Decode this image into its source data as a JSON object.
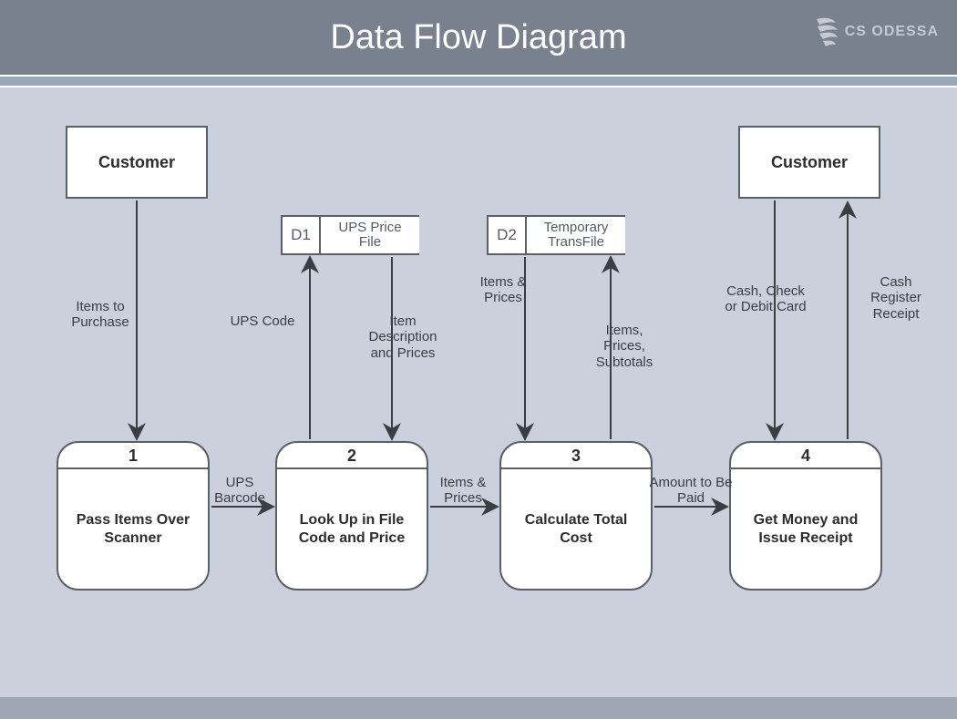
{
  "header": {
    "title": "Data Flow Diagram",
    "brand": "CS ODESSA"
  },
  "entities": {
    "customer_left": "Customer",
    "customer_right": "Customer"
  },
  "datastores": {
    "d1": {
      "id": "D1",
      "name": "UPS Price File"
    },
    "d2": {
      "id": "D2",
      "name": "Temporary TransFile"
    }
  },
  "processes": {
    "p1": {
      "num": "1",
      "label": "Pass Items Over Scanner"
    },
    "p2": {
      "num": "2",
      "label": "Look Up in File Code and Price"
    },
    "p3": {
      "num": "3",
      "label": "Calculate Total Cost"
    },
    "p4": {
      "num": "4",
      "label": "Get Money and Issue Receipt"
    }
  },
  "flows": {
    "items_to_purchase": "Items to Purchase",
    "ups_barcode": "UPS Barcode",
    "ups_code": "UPS Code",
    "item_desc_prices": "Item Description and Prices",
    "items_prices_1": "Items & Prices",
    "items_prices_2": "Items & Prices",
    "items_prices_subtotals": "Items, Prices, Subtotals",
    "amount_to_be_paid": "Amount to Be Paid",
    "cash_check_debit": "Cash, Check or Debit Card",
    "cash_register_receipt": "Cash Register Receipt"
  }
}
